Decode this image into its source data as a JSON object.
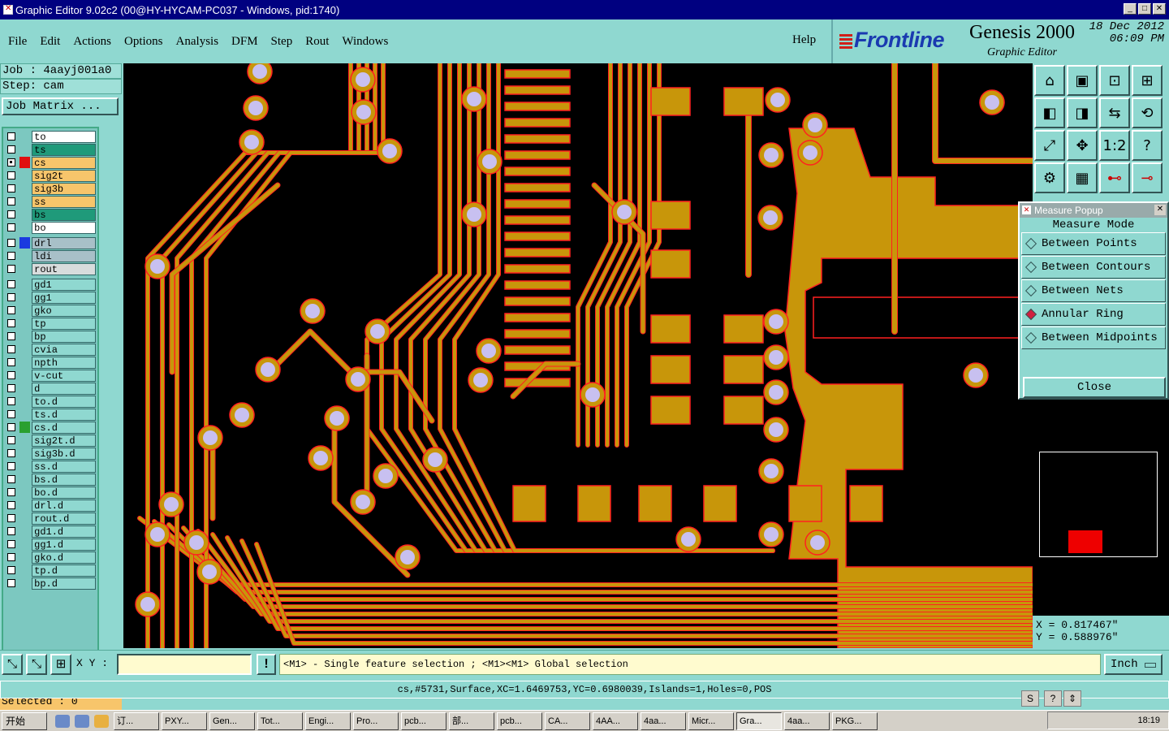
{
  "window": {
    "title": "Graphic Editor 9.02c2 (00@HY-HYCAM-PC037 - Windows, pid:1740)"
  },
  "menu": [
    {
      "label": "File"
    },
    {
      "label": "Edit"
    },
    {
      "label": "Actions"
    },
    {
      "label": "Options"
    },
    {
      "label": "Analysis"
    },
    {
      "label": "DFM"
    },
    {
      "label": "Step"
    },
    {
      "label": "Rout"
    },
    {
      "label": "Windows"
    }
  ],
  "help_label": "Help",
  "brand": {
    "logo": "Frontline",
    "product": "Genesis 2000",
    "subtitle": "Graphic Editor",
    "date": "18 Dec 2012",
    "time": "06:09 PM"
  },
  "job": {
    "job_line": "Job : 4aayj001a0",
    "step_line": "Step: cam",
    "matrix_button": "Job Matrix ..."
  },
  "layer_groups": [
    [
      {
        "name": "to",
        "color": "#ffffff",
        "mark": "",
        "checked": false
      },
      {
        "name": "ts",
        "color": "#1f9a7a",
        "mark": "",
        "checked": false
      },
      {
        "name": "cs",
        "color": "#f7c56b",
        "mark": "#e01010",
        "checked": true
      },
      {
        "name": "sig2t",
        "color": "#f7c56b",
        "mark": "",
        "checked": false
      },
      {
        "name": "sig3b",
        "color": "#f7c56b",
        "mark": "",
        "checked": false
      },
      {
        "name": "ss",
        "color": "#f7c56b",
        "mark": "",
        "checked": false
      },
      {
        "name": "bs",
        "color": "#1f9a7a",
        "mark": "",
        "checked": false
      },
      {
        "name": "bo",
        "color": "#ffffff",
        "mark": "",
        "checked": false
      }
    ],
    [
      {
        "name": "drl",
        "color": "#a8c0c8",
        "mark": "#1a3ae0",
        "checked": false
      },
      {
        "name": "ldi",
        "color": "#a8c0c8",
        "mark": "",
        "checked": false
      },
      {
        "name": "rout",
        "color": "#d8dcdc",
        "mark": "",
        "checked": false
      }
    ],
    [
      {
        "name": "gd1",
        "color": "#8fd8d0",
        "mark": "",
        "checked": false
      },
      {
        "name": "gg1",
        "color": "#8fd8d0",
        "mark": "",
        "checked": false
      },
      {
        "name": "gko",
        "color": "#8fd8d0",
        "mark": "",
        "checked": false
      },
      {
        "name": "tp",
        "color": "#8fd8d0",
        "mark": "",
        "checked": false
      },
      {
        "name": "bp",
        "color": "#8fd8d0",
        "mark": "",
        "checked": false
      },
      {
        "name": "cvia",
        "color": "#8fd8d0",
        "mark": "",
        "checked": false
      },
      {
        "name": "npth",
        "color": "#8fd8d0",
        "mark": "",
        "checked": false
      },
      {
        "name": "v-cut",
        "color": "#8fd8d0",
        "mark": "",
        "checked": false
      },
      {
        "name": "d",
        "color": "#8fd8d0",
        "mark": "",
        "checked": false
      },
      {
        "name": "to.d",
        "color": "#8fd8d0",
        "mark": "",
        "checked": false
      },
      {
        "name": "ts.d",
        "color": "#8fd8d0",
        "mark": "",
        "checked": false
      },
      {
        "name": "cs.d",
        "color": "#8fd8d0",
        "mark": "#2aa030",
        "checked": false
      },
      {
        "name": "sig2t.d",
        "color": "#8fd8d0",
        "mark": "",
        "checked": false
      },
      {
        "name": "sig3b.d",
        "color": "#8fd8d0",
        "mark": "",
        "checked": false
      },
      {
        "name": "ss.d",
        "color": "#8fd8d0",
        "mark": "",
        "checked": false
      },
      {
        "name": "bs.d",
        "color": "#8fd8d0",
        "mark": "",
        "checked": false
      },
      {
        "name": "bo.d",
        "color": "#8fd8d0",
        "mark": "",
        "checked": false
      },
      {
        "name": "drl.d",
        "color": "#8fd8d0",
        "mark": "",
        "checked": false
      },
      {
        "name": "rout.d",
        "color": "#8fd8d0",
        "mark": "",
        "checked": false
      },
      {
        "name": "gd1.d",
        "color": "#8fd8d0",
        "mark": "",
        "checked": false
      },
      {
        "name": "gg1.d",
        "color": "#8fd8d0",
        "mark": "",
        "checked": false
      },
      {
        "name": "gko.d",
        "color": "#8fd8d0",
        "mark": "",
        "checked": false
      },
      {
        "name": "tp.d",
        "color": "#8fd8d0",
        "mark": "",
        "checked": false
      },
      {
        "name": "bp.d",
        "color": "#8fd8d0",
        "mark": "",
        "checked": false
      }
    ]
  ],
  "selected_label": "Selected : 0",
  "measure_popup": {
    "title": "Measure Popup",
    "mode_label": "Measure Mode",
    "options": [
      {
        "label": "Between Points",
        "selected": false
      },
      {
        "label": "Between Contours",
        "selected": false
      },
      {
        "label": "Between Nets",
        "selected": false
      },
      {
        "label": "Annular Ring",
        "selected": true
      },
      {
        "label": "Between Midpoints",
        "selected": false
      }
    ],
    "close_label": "Close"
  },
  "coords": {
    "x_line": "X = 0.817467\"",
    "y_line": "Y = 0.588976\""
  },
  "bottom": {
    "xy_label": "X Y :",
    "xy_value": "",
    "message": "<M1> - Single feature selection ; <M1><M1> Global selection",
    "unit": "Inch"
  },
  "status_line": "cs,#5731,Surface,XC=1.6469753,YC=0.6980039,Islands=1,Holes=0,POS",
  "taskbar": {
    "start_label": "开始",
    "tasks": [
      "订...",
      "PXY...",
      "Gen...",
      "Tot...",
      "Engi...",
      "Pro...",
      "pcb...",
      "部...",
      "pcb...",
      "CA...",
      "4AA...",
      "4aa...",
      "Micr...",
      "Gra...",
      "4aa...",
      "PKG..."
    ],
    "active_task": "Gra...",
    "clock": "18:19"
  },
  "colors": {
    "copper": "#c8960a",
    "pad_fill": "#c8c0f0",
    "outline": "#ff2020",
    "board_bg": "#000000"
  }
}
